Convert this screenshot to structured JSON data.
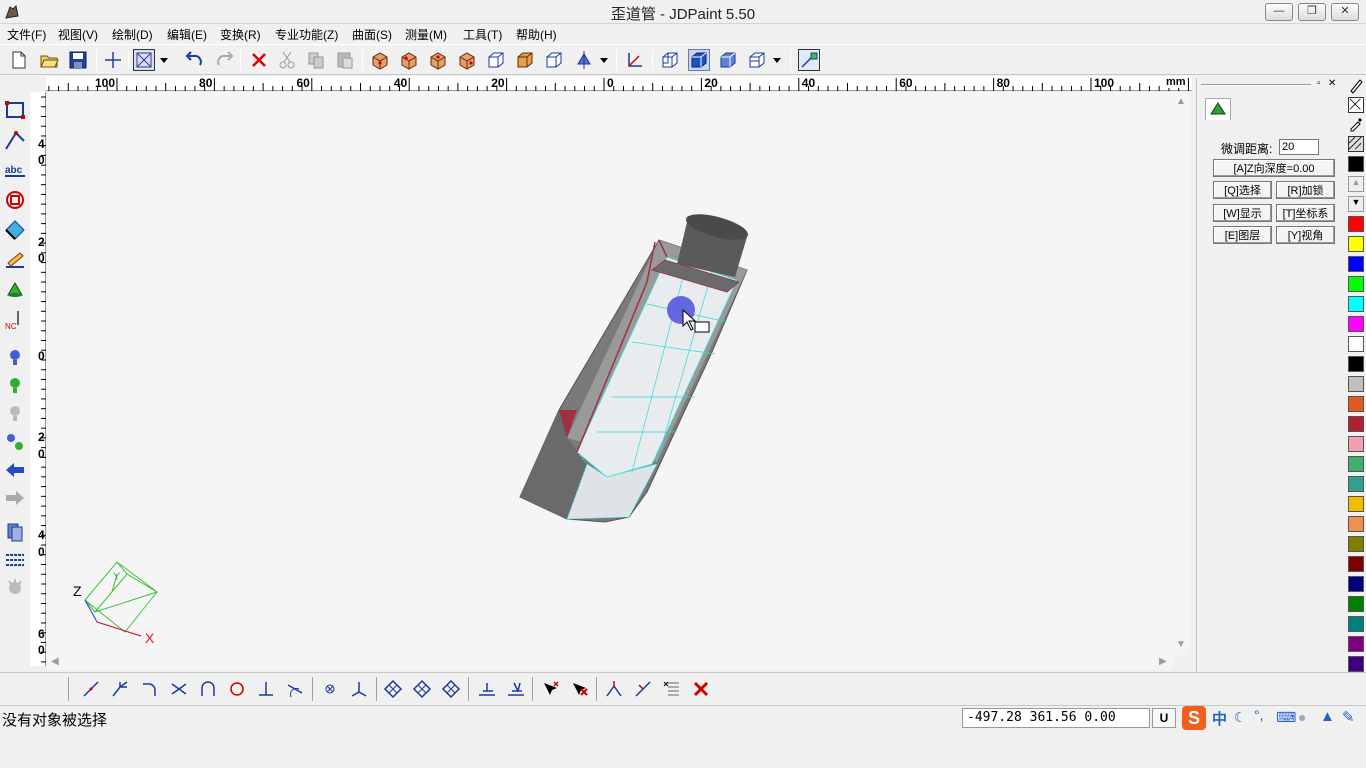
{
  "window": {
    "title": "歪道管 - JDPaint 5.50",
    "minimize_label": "—",
    "restore_label": "❐",
    "close_label": "✕"
  },
  "menu": [
    {
      "label": "文件(F)"
    },
    {
      "label": "视图(V)"
    },
    {
      "label": "绘制(D)"
    },
    {
      "label": "编辑(E)"
    },
    {
      "label": "变换(R)"
    },
    {
      "label": "专业功能(Z)"
    },
    {
      "label": "曲面(S)"
    },
    {
      "label": "测量(M)"
    },
    {
      "label": "工具(T)"
    },
    {
      "label": "帮助(H)"
    }
  ],
  "ruler": {
    "top_labels": [
      "100",
      "80",
      "60",
      "40",
      "20",
      "0",
      "20",
      "40",
      "60",
      "80",
      "100"
    ],
    "unit": "mm",
    "left_labels": [
      "4",
      "0",
      "2",
      "0",
      "0",
      "2",
      "0",
      "4",
      "0",
      "6",
      "0"
    ]
  },
  "axes": {
    "x": "X",
    "y": "Y",
    "z": "Z"
  },
  "panel": {
    "fine_tune_label": "微调距离:",
    "fine_tune_value": "20",
    "z_depth_label": "[A]Z向深度=0.00",
    "select_label": "[Q]选择",
    "lock_label": "[R]加锁",
    "display_label": "[W]显示",
    "coord_label": "[T]坐标系",
    "layer_label": "[E]图层",
    "view_label": "[Y]视角"
  },
  "palette_colors": [
    "#ff0000",
    "#ffff00",
    "#0000ff",
    "#00ff00",
    "#00ffff",
    "#ff00ff",
    "#ffffff",
    "#000000",
    "#c0c0c0",
    "#e05a20",
    "#b02030",
    "#f0a0b0",
    "#40b070",
    "#30a090",
    "#f0c000",
    "#f09050",
    "#808000",
    "#800000",
    "#000080",
    "#008000",
    "#008080",
    "#800080",
    "#400080"
  ],
  "status": {
    "message": "没有对象被选择",
    "coordinates": "-497.28 361.56 0.00",
    "unit": "U"
  },
  "ime": {
    "logo": "S",
    "lang": "中"
  }
}
